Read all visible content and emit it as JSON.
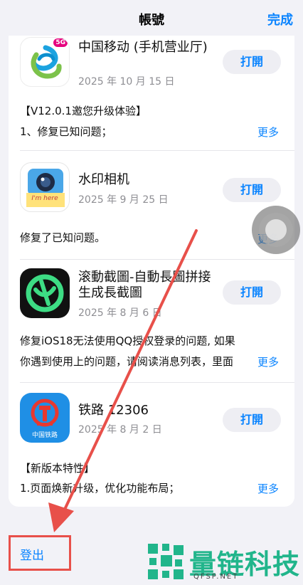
{
  "header": {
    "title": "帳號",
    "done_label": "完成"
  },
  "apps": [
    {
      "name": "中国移动 (手机营业厅)",
      "date": "2025 年 10 月 15 日",
      "button": "打開",
      "badge": "5G",
      "notes": [
        "【V12.0.1邀您升级体验】",
        "1、修复已知问题；"
      ],
      "more": "更多"
    },
    {
      "name": "水印相机",
      "date": "2025 年 9 月 25 日",
      "button": "打開",
      "icon_caption": "I'm here",
      "notes": [
        "修复了已知问题。"
      ],
      "more": "更多"
    },
    {
      "name": "滚動截圖-自動長圖拼接生成長截圖",
      "date": "2025 年 8 月 6 日",
      "button": "打開",
      "notes": [
        "修复iOS18无法使用QQ授权登录的问题, 如果",
        "你遇到使用上的问题，请阅读消息列表，里面"
      ],
      "more": "更多"
    },
    {
      "name": "铁路 12306",
      "date": "2025 年 8 月 2 日",
      "button": "打開",
      "icon_caption": "中国铁路",
      "notes": [
        "【新版本特性】",
        "1.页面焕新升级，优化功能布局；"
      ],
      "more": "更多"
    }
  ],
  "footer": {
    "logout_label": "登出"
  },
  "watermark": {
    "brand": "量链科技",
    "site": "QFSP.NET"
  },
  "colors": {
    "accent": "#0a84ff",
    "annotation": "#e8504a",
    "watermark": "#21b58b"
  }
}
